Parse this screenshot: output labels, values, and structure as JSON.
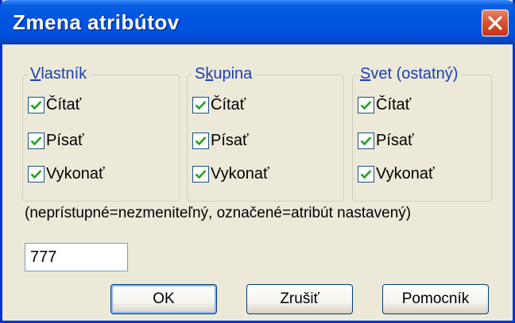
{
  "window": {
    "title": "Zmena atribútov",
    "close_icon": "close-icon"
  },
  "groups": [
    {
      "label_accel": "V",
      "label_rest": "lastník",
      "items": [
        {
          "label": "Čítať",
          "checked": true
        },
        {
          "label": "Písať",
          "checked": true
        },
        {
          "label": "Vykonať",
          "checked": true
        }
      ]
    },
    {
      "label_pre": "S",
      "label_accel": "k",
      "label_rest": "upina",
      "items": [
        {
          "label": "Čítať",
          "checked": true
        },
        {
          "label": "Písať",
          "checked": true
        },
        {
          "label": "Vykonať",
          "checked": true
        }
      ]
    },
    {
      "label_accel": "S",
      "label_rest": "vet (ostatný)",
      "items": [
        {
          "label": "Čítať",
          "checked": true
        },
        {
          "label": "Písať",
          "checked": true
        },
        {
          "label": "Vykonať",
          "checked": true
        }
      ]
    }
  ],
  "hint": "(neprístupné=nezmeniteľný, označené=atribút nastavený)",
  "mode_value": "777",
  "buttons": {
    "ok": "OK",
    "cancel": "Zrušiť",
    "help": "Pomocník"
  },
  "colors": {
    "title_bar": "#0054e3",
    "group_label": "#1c3fb0",
    "check_mark": "#21a121",
    "dialog_bg": "#ece9d8"
  }
}
